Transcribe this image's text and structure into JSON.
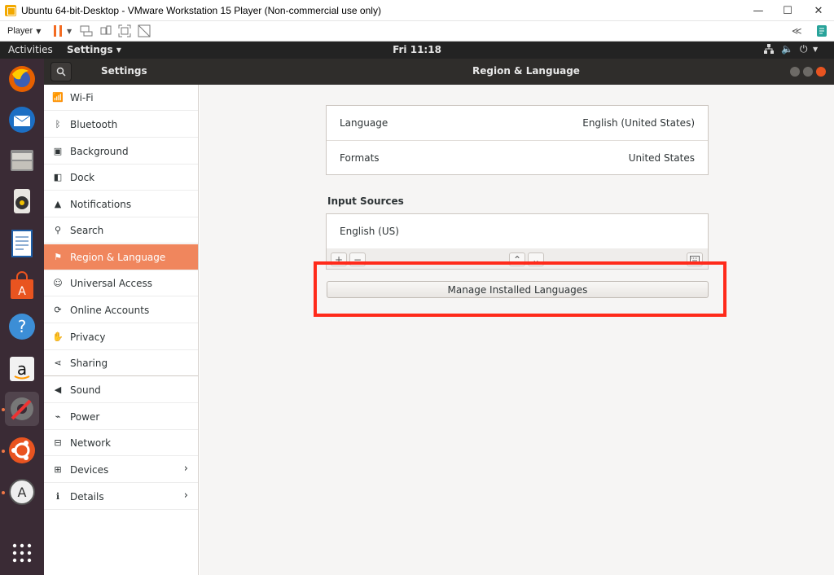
{
  "vmware": {
    "window_title": "Ubuntu 64-bit-Desktop - VMware Workstation 15 Player (Non-commercial use only)",
    "player_menu": "Player",
    "window_controls": {
      "minimize": "—",
      "maximize": "☐",
      "close": "✕"
    }
  },
  "topbar": {
    "activities": "Activities",
    "app_menu": "Settings ▾",
    "clock": "Fri 11:18"
  },
  "settings": {
    "title": "Settings",
    "panel_title": "Region & Language",
    "sidebar": [
      {
        "label": "Wi-Fi",
        "icon": "wifi-icon"
      },
      {
        "label": "Bluetooth",
        "icon": "bluetooth-icon"
      },
      {
        "label": "Background",
        "icon": "background-icon"
      },
      {
        "label": "Dock",
        "icon": "dock-icon"
      },
      {
        "label": "Notifications",
        "icon": "bell-icon"
      },
      {
        "label": "Search",
        "icon": "search-icon"
      },
      {
        "label": "Region & Language",
        "icon": "flag-icon"
      },
      {
        "label": "Universal Access",
        "icon": "accessibility-icon"
      },
      {
        "label": "Online Accounts",
        "icon": "online-accounts-icon"
      },
      {
        "label": "Privacy",
        "icon": "hand-icon"
      },
      {
        "label": "Sharing",
        "icon": "share-icon"
      },
      {
        "label": "Sound",
        "icon": "speaker-icon"
      },
      {
        "label": "Power",
        "icon": "power-plug-icon"
      },
      {
        "label": "Network",
        "icon": "network-icon"
      },
      {
        "label": "Devices",
        "icon": "devices-icon"
      },
      {
        "label": "Details",
        "icon": "info-icon"
      }
    ],
    "selected_index": 6
  },
  "region": {
    "language_label": "Language",
    "language_value": "English (United States)",
    "formats_label": "Formats",
    "formats_value": "United States",
    "input_sources_title": "Input Sources",
    "input_source": "English (US)",
    "add_button": "+",
    "remove_button": "−",
    "up_button": "⌃",
    "down_button": "⌄",
    "manage_button": "Manage Installed Languages"
  },
  "colors": {
    "accent": "#f0865d",
    "highlight": "#ff2a1a",
    "dock_bg": "#3a2b35"
  }
}
